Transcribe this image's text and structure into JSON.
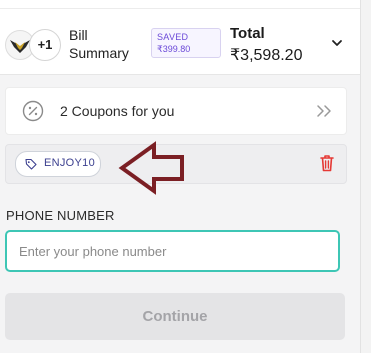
{
  "summary": {
    "extra_items_badge": "+1",
    "bill_label": "Bill Summary",
    "saved_label": "SAVED",
    "saved_amount": "₹399.80",
    "total_label": "Total",
    "total_value": "₹3,598.20",
    "expand_icon": "chevron-down-icon"
  },
  "coupons": {
    "label": "2 Coupons for you",
    "icon": "percent-badge-icon",
    "action_icon": "double-chevron-right-icon"
  },
  "applied_coupon": {
    "code": "ENJOY10",
    "icon": "tag-icon",
    "remove_icon": "trash-icon",
    "remove_color": "#e53935"
  },
  "annotation": {
    "arrow_color": "#7b1f24"
  },
  "phone": {
    "label": "PHONE NUMBER",
    "placeholder": "Enter your phone number",
    "value": ""
  },
  "continue_button": {
    "label": "Continue"
  },
  "colors": {
    "accent_teal": "#3dc6b5",
    "saved_purple": "#6b49d8"
  }
}
